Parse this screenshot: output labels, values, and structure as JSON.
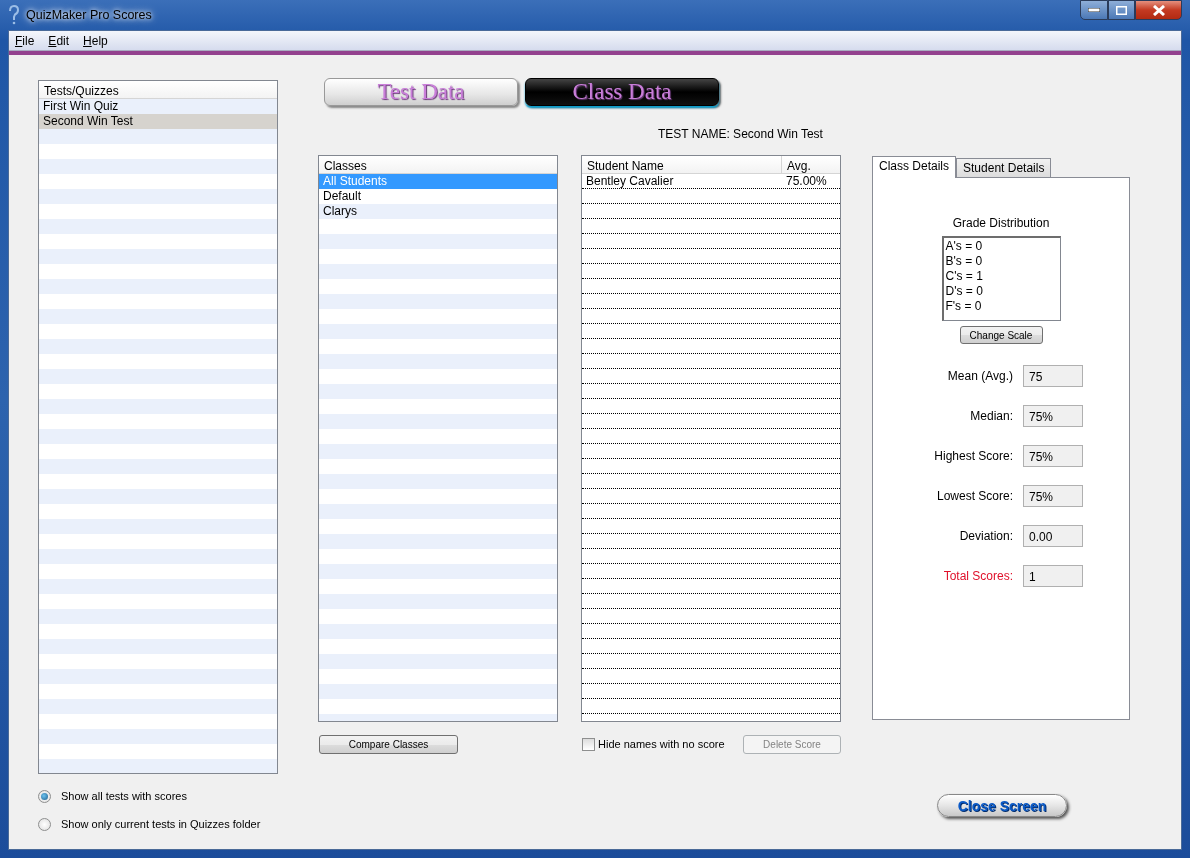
{
  "window": {
    "title": "QuizMaker Pro Scores"
  },
  "menu": [
    {
      "label": "File"
    },
    {
      "label": "Edit"
    },
    {
      "label": "Help"
    }
  ],
  "tests_list": {
    "header": "Tests/Quizzes",
    "items": [
      {
        "label": "First Win Quiz",
        "selected": false
      },
      {
        "label": "Second Win Test",
        "selected": true
      }
    ]
  },
  "filter_options": [
    {
      "label": "Show all tests with scores",
      "selected": true
    },
    {
      "label": "Show only current tests in Quizzes folder",
      "selected": false
    }
  ],
  "view_buttons": [
    {
      "label": "Test Data",
      "selected": false
    },
    {
      "label": "Class Data",
      "selected": true
    }
  ],
  "test_name": "TEST NAME: Second Win Test",
  "classes_list": {
    "header": "Classes",
    "items": [
      {
        "label": "All Students",
        "selected": true
      },
      {
        "label": "Default",
        "selected": false
      },
      {
        "label": "Clarys",
        "selected": false
      }
    ]
  },
  "students_table": {
    "columns": [
      "Student Name",
      "Avg."
    ],
    "rows": [
      [
        "Bentley Cavalier",
        "75.00%"
      ]
    ]
  },
  "detail_tabs": [
    {
      "label": "Class Details",
      "selected": true
    },
    {
      "label": "Student Details",
      "selected": false
    }
  ],
  "grade_distribution": {
    "title": "Grade Distribution",
    "lines": [
      "A's = 0",
      "B's = 0",
      "C's = 1",
      "D's = 0",
      "F's = 0"
    ]
  },
  "change_scale_button": {
    "label": "Change Scale"
  },
  "stats": [
    {
      "label": "Mean (Avg.)",
      "value": "75",
      "emphasized": false
    },
    {
      "label": "Median:",
      "value": "75%",
      "emphasized": false
    },
    {
      "label": "Highest Score:",
      "value": "75%",
      "emphasized": false
    },
    {
      "label": "Lowest Score:",
      "value": "75%",
      "emphasized": false
    },
    {
      "label": "Deviation:",
      "value": "0.00",
      "emphasized": false
    },
    {
      "label": "Total Scores:",
      "value": "1",
      "emphasized": true
    }
  ],
  "compare_button": {
    "label": "Compare Classes"
  },
  "hide_no_score": {
    "label": "Hide names with no score",
    "checked": false
  },
  "delete_button": {
    "label": "Delete Score",
    "disabled": true
  },
  "close_button": {
    "label": "Close Screen"
  }
}
